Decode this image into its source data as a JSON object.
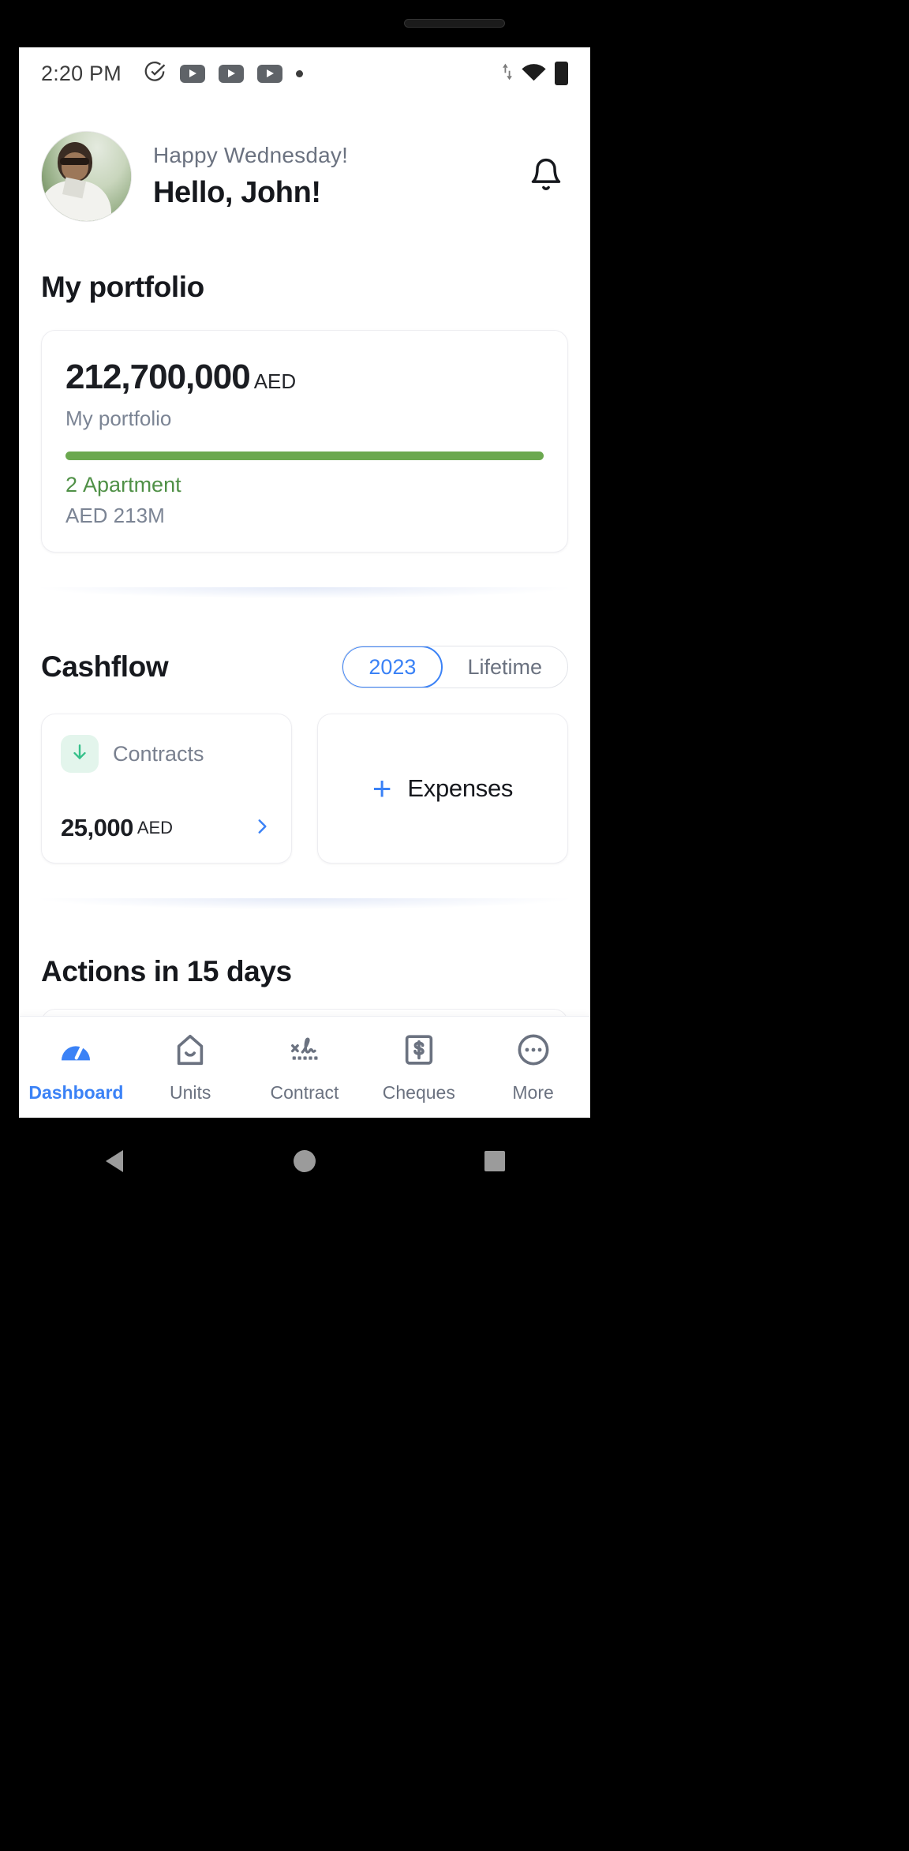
{
  "status_bar": {
    "time": "2:20 PM",
    "icons": [
      "check-circle-icon",
      "youtube-icon",
      "youtube-icon",
      "youtube-icon",
      "dot-icon"
    ],
    "right_icons": [
      "data-transfer-icon",
      "wifi-icon",
      "battery-icon"
    ]
  },
  "header": {
    "greeting": "Happy Wednesday!",
    "hello": "Hello, John!",
    "avatar": "user-avatar",
    "bell": "notification-bell-icon"
  },
  "portfolio": {
    "section_title": "My portfolio",
    "amount": "212,700,000",
    "currency": "AED",
    "subtitle": "My portfolio",
    "legend_count": "2",
    "legend_type": "Apartment",
    "legend_value": "AED 213M",
    "bar_color": "#6ba84f",
    "bar_percent": 100
  },
  "cashflow": {
    "section_title": "Cashflow",
    "periods": [
      {
        "label": "2023",
        "active": true
      },
      {
        "label": "Lifetime",
        "active": false
      }
    ],
    "contracts": {
      "label": "Contracts",
      "amount": "25,000",
      "currency": "AED",
      "icon": "arrow-down-icon",
      "icon_color": "#35c08a",
      "chevron": "chevron-right-icon"
    },
    "expenses": {
      "plus": "+",
      "label": "Expenses",
      "accent": "#3b82f6"
    }
  },
  "actions": {
    "section_title": "Actions in 15 days"
  },
  "bottom_nav": {
    "items": [
      {
        "label": "Dashboard",
        "icon": "speedometer-icon",
        "active": true
      },
      {
        "label": "Units",
        "icon": "home-icon",
        "active": false
      },
      {
        "label": "Contract",
        "icon": "signature-icon",
        "active": false
      },
      {
        "label": "Cheques",
        "icon": "dollar-document-icon",
        "active": false
      },
      {
        "label": "More",
        "icon": "more-dots-icon",
        "active": false
      }
    ],
    "active_color": "#3b82f6",
    "inactive_color": "#6b7280"
  },
  "android_nav": {
    "back": "back-triangle-icon",
    "home": "home-circle-icon",
    "recents": "recents-square-icon"
  }
}
